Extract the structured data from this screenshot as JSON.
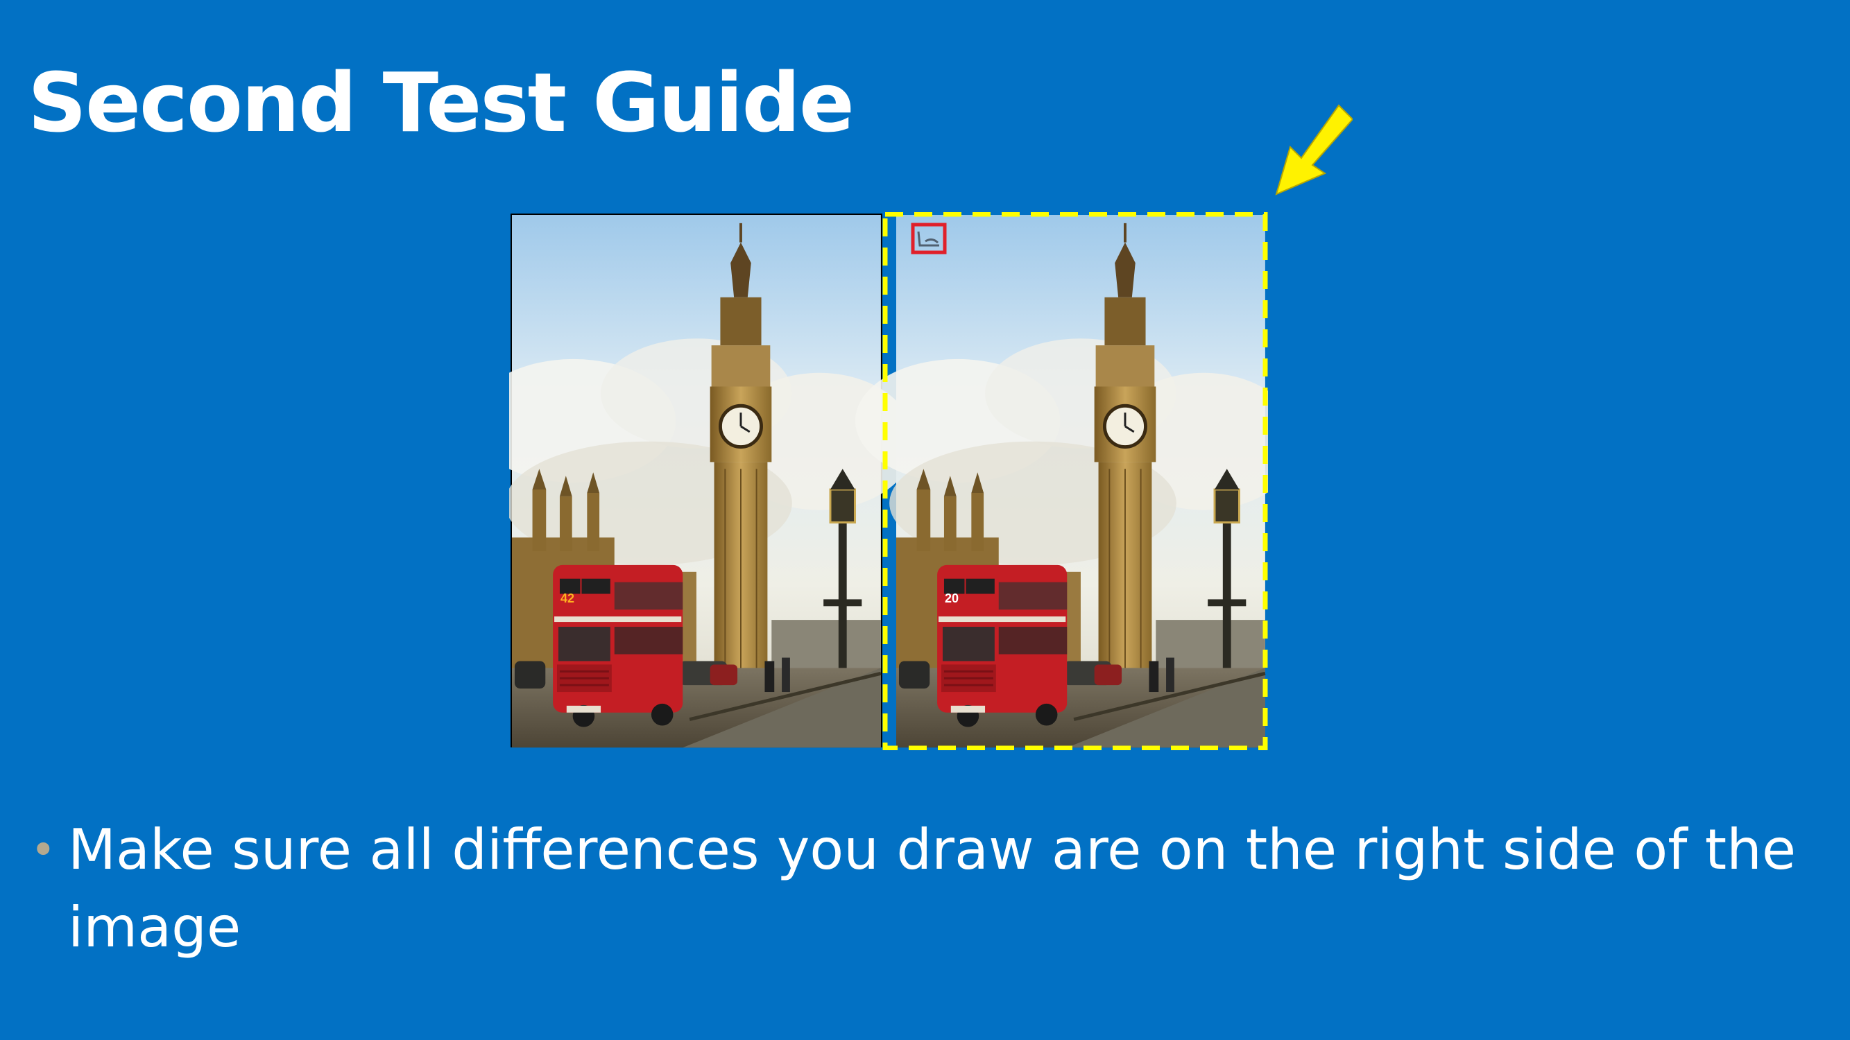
{
  "slide": {
    "title": "Second Test Guide",
    "bullet": "Make sure all differences you draw are on the right side of the image",
    "bullet_icon": "bullet-dot"
  },
  "images": {
    "left_panel": "original-photo",
    "right_panel": "edited-photo",
    "bus_number_left": "42",
    "bus_number_right": "20"
  },
  "colors": {
    "background": "#0271C4",
    "highlight_dash": "#FFFF00",
    "arrow": "#FFF200",
    "difference_marker": "#E0202A",
    "bus": "#C41E24"
  }
}
